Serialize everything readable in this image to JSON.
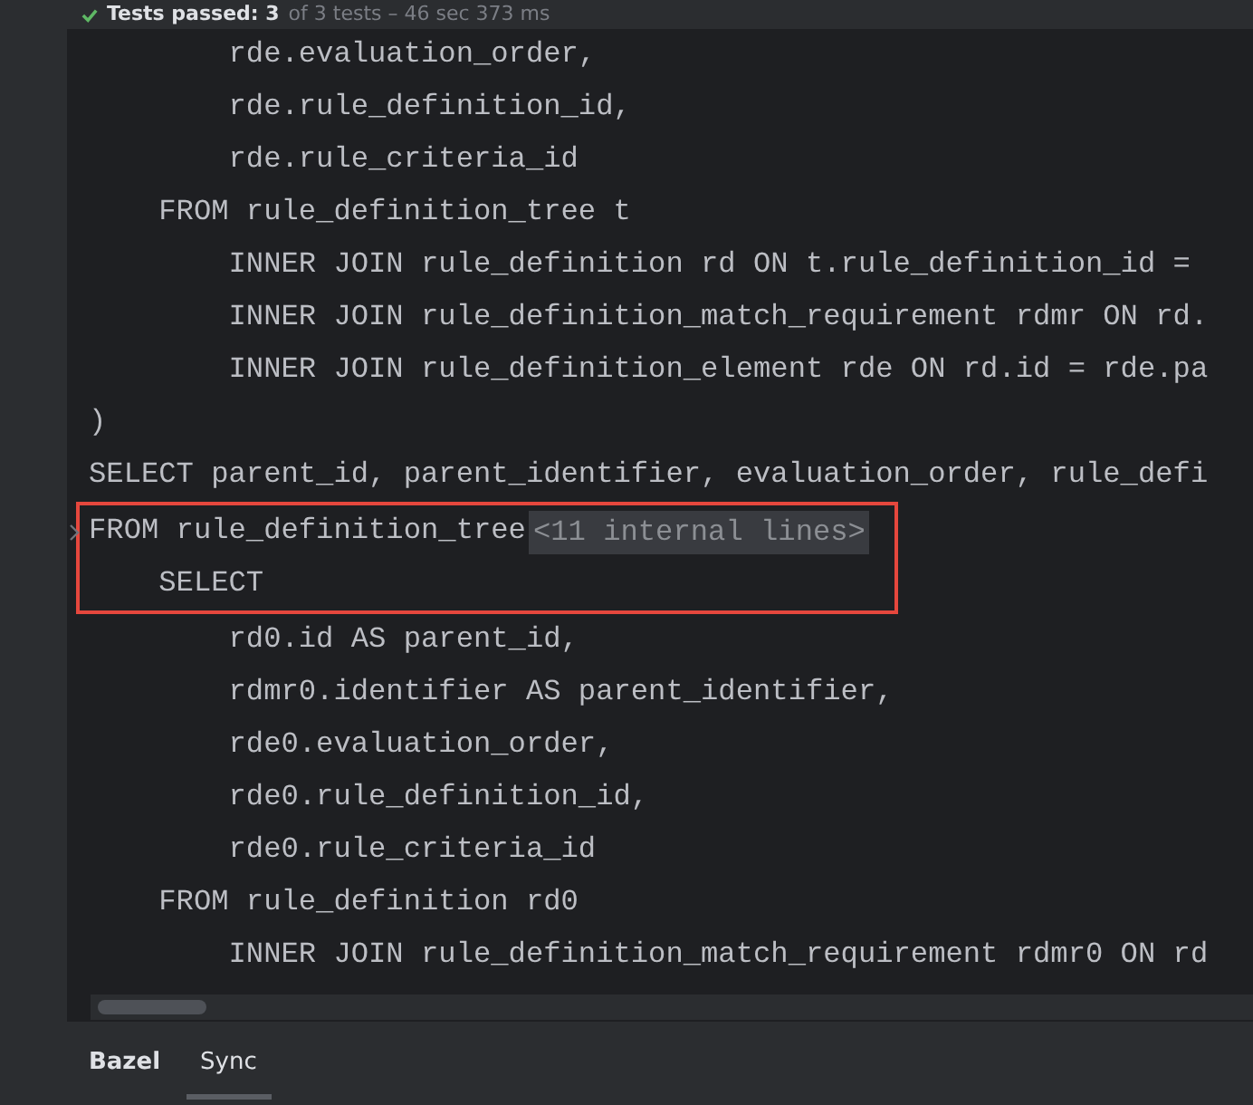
{
  "test_status": {
    "passed": true,
    "title": "Tests passed: 3",
    "detail": "of 3 tests – 46 sec 373 ms"
  },
  "code_lines": [
    {
      "text": "        rde.evaluation_order,",
      "highlighted": false,
      "folded": false
    },
    {
      "text": "        rde.rule_definition_id,",
      "highlighted": false,
      "folded": false
    },
    {
      "text": "        rde.rule_criteria_id",
      "highlighted": false,
      "folded": false
    },
    {
      "text": "    FROM rule_definition_tree t",
      "highlighted": false,
      "folded": false
    },
    {
      "text": "        INNER JOIN rule_definition rd ON t.rule_definition_id =",
      "highlighted": false,
      "folded": false
    },
    {
      "text": "        INNER JOIN rule_definition_match_requirement rdmr ON rd.",
      "highlighted": false,
      "folded": false
    },
    {
      "text": "        INNER JOIN rule_definition_element rde ON rd.id = rde.pa",
      "highlighted": false,
      "folded": false
    },
    {
      "text": ")",
      "highlighted": false,
      "folded": false
    },
    {
      "text": "SELECT parent_id, parent_identifier, evaluation_order, rule_defi",
      "highlighted": false,
      "folded": false
    },
    {
      "text": "FROM rule_definition_tree",
      "highlighted": true,
      "folded": true,
      "fold_placeholder": "<11 internal lines>"
    },
    {
      "text": "    SELECT",
      "highlighted": true,
      "folded": false
    },
    {
      "text": "        rd0.id AS parent_id,",
      "highlighted": false,
      "folded": false
    },
    {
      "text": "        rdmr0.identifier AS parent_identifier,",
      "highlighted": false,
      "folded": false
    },
    {
      "text": "        rde0.evaluation_order,",
      "highlighted": false,
      "folded": false
    },
    {
      "text": "        rde0.rule_definition_id,",
      "highlighted": false,
      "folded": false
    },
    {
      "text": "        rde0.rule_criteria_id",
      "highlighted": false,
      "folded": false
    },
    {
      "text": "    FROM rule_definition rd0",
      "highlighted": false,
      "folded": false
    },
    {
      "text": "        INNER JOIN rule_definition_match_requirement rdmr0 ON rd",
      "highlighted": false,
      "folded": false
    }
  ],
  "tool_tabs": [
    {
      "label": "Bazel",
      "selected": false
    },
    {
      "label": "Sync",
      "selected": true
    }
  ]
}
